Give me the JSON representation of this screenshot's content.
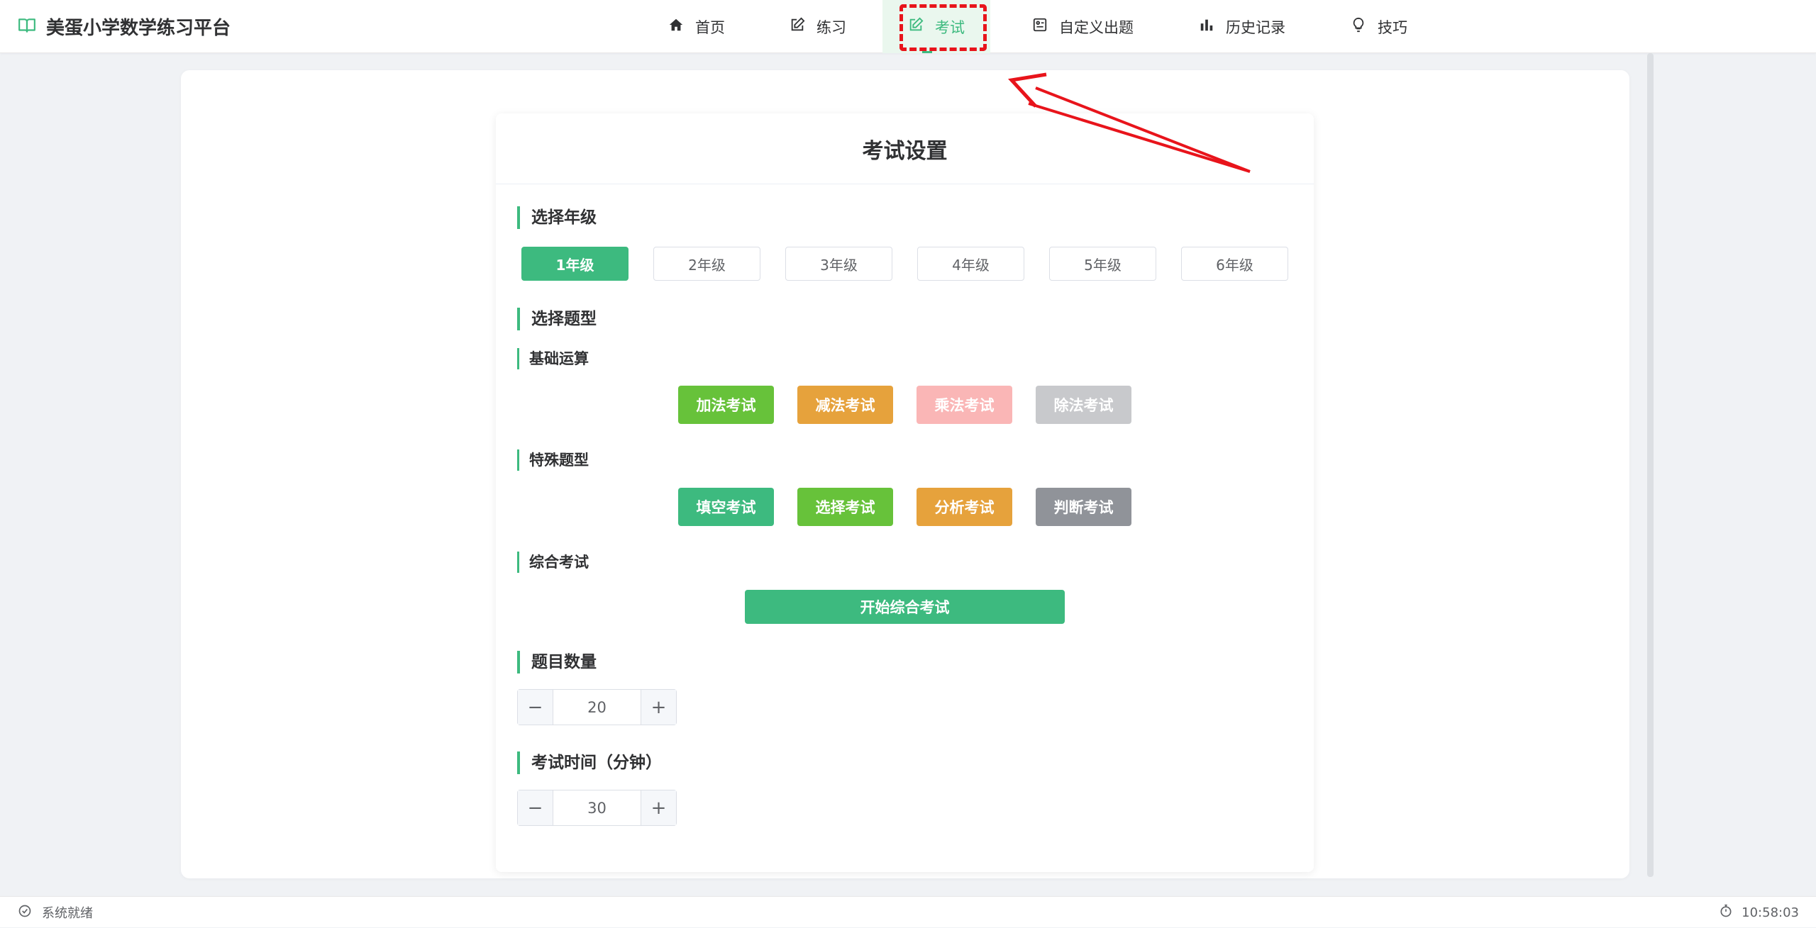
{
  "header": {
    "brand_icon": "book-open-icon",
    "brand_title": "美蛋小学数学练习平台",
    "nav": [
      {
        "label": "首页",
        "icon": "home-icon"
      },
      {
        "label": "练习",
        "icon": "edit-icon"
      },
      {
        "label": "考试",
        "icon": "edit-icon",
        "active": true
      },
      {
        "label": "自定义出题",
        "icon": "custom-quiz-icon"
      },
      {
        "label": "历史记录",
        "icon": "bar-chart-icon"
      },
      {
        "label": "技巧",
        "icon": "lightbulb-icon"
      }
    ]
  },
  "exam": {
    "title": "考试设置",
    "grade_heading": "选择年级",
    "grades": [
      "1年级",
      "2年级",
      "3年级",
      "4年级",
      "5年级",
      "6年级"
    ],
    "selected_grade": "1年级",
    "type_heading": "选择题型",
    "basic_heading": "基础运算",
    "basic_buttons": [
      {
        "label": "加法考试",
        "color": "#67c23a"
      },
      {
        "label": "减法考试",
        "color": "#e6a23c"
      },
      {
        "label": "乘法考试",
        "color": "#fab6b6"
      },
      {
        "label": "除法考试",
        "color": "#c8c9cc"
      }
    ],
    "special_heading": "特殊题型",
    "special_buttons": [
      {
        "label": "填空考试",
        "color": "#3dba7f"
      },
      {
        "label": "选择考试",
        "color": "#67c23a"
      },
      {
        "label": "分析考试",
        "color": "#e6a23c"
      },
      {
        "label": "判断考试",
        "color": "#909399"
      }
    ],
    "comprehensive_heading": "综合考试",
    "comprehensive_button": "开始综合考试",
    "count_heading": "题目数量",
    "count_value": "20",
    "time_heading": "考试时间（分钟）",
    "time_value": "30",
    "minus_symbol": "−",
    "plus_symbol": "+"
  },
  "footer": {
    "status_icon": "check-circle-icon",
    "status": "系统就绪",
    "clock_icon": "stopwatch-icon",
    "time": "10:58:03"
  },
  "colors": {
    "accent": "#3dba7f",
    "annotation": "#e8141b"
  }
}
